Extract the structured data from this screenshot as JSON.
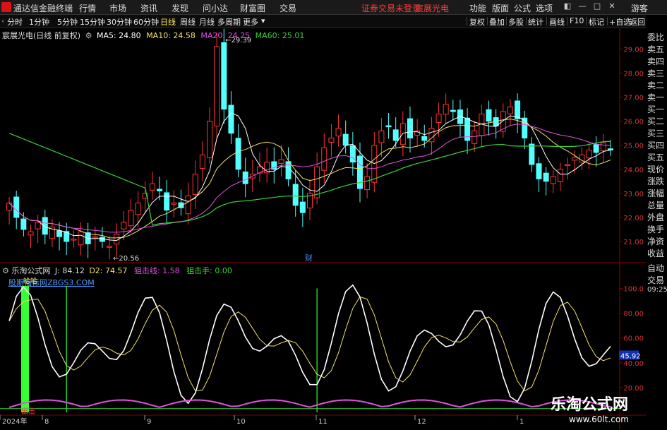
{
  "app": {
    "title": "通达信金融终端",
    "menu": [
      "行情",
      "市场",
      "资讯",
      "发现",
      "问小达",
      "财富圈",
      "交易"
    ],
    "status_red": [
      "证券交易未登录",
      "宸展光电"
    ],
    "right_menu": [
      "功能",
      "版面",
      "公式",
      "选项"
    ],
    "guest": "游客"
  },
  "periods": [
    "分时",
    "1分钟",
    "5分钟",
    "15分钟",
    "30分钟",
    "60分钟",
    "日线",
    "周线",
    "月线",
    "多周期",
    "更多"
  ],
  "active_period": "日线",
  "tools": [
    "复权",
    "叠加",
    "多股",
    "统计",
    "画线",
    "F10",
    "标记",
    "+自选",
    "返回"
  ],
  "price_panel": {
    "stock": "宸展光电(日线 前复权)",
    "ma": [
      {
        "label": "MA5: 24.80",
        "color": "#ffffff"
      },
      {
        "label": "MA10: 24.58",
        "color": "#f3e36a"
      },
      {
        "label": "MA20: 24.25",
        "color": "#e052e0"
      },
      {
        "label": "MA60: 25.01",
        "color": "#3bd23b"
      }
    ],
    "high_label": "29.39",
    "low_label": "20.56",
    "fin_marker": "财",
    "y_ticks": [
      "29.00",
      "28.00",
      "27.00",
      "26.00",
      "25.00",
      "24.00",
      "23.00",
      "22.00",
      "21.00"
    ]
  },
  "indicator_panel": {
    "name": "乐淘公式网",
    "j": "J: 84.12",
    "d2": "D2: 74.57",
    "line1": "狙击线: 1.58",
    "line2": "狙击手: 0.00",
    "site_text": "股期指标网ZBGS3.COM",
    "tag_top": "哈哈",
    "tag_bottom": "出击",
    "y_ticks": [
      "100.0",
      "80.00",
      "60.00",
      "40.00",
      "20.00"
    ],
    "current_value": "45.92"
  },
  "x_axis": [
    "2024年",
    "8",
    "9",
    "10",
    "11",
    "12",
    "1"
  ],
  "side_panel": [
    "委比",
    "卖五",
    "卖四",
    "卖三",
    "卖二",
    "卖一",
    "买一",
    "买二",
    "买三",
    "买四",
    "买五",
    "现价",
    "涨跌",
    "涨幅",
    "总量",
    "外盘",
    "换手",
    "净资",
    "收益",
    "自动",
    "交易",
    "09:25"
  ],
  "watermark": {
    "title": "乐淘公式网",
    "url": "www.60lt.com"
  },
  "colors": {
    "up": "#ff3333",
    "down": "#54ffff",
    "ma5": "#ffffff",
    "ma10": "#f3e36a",
    "ma20": "#e052e0",
    "ma60": "#3bd23b",
    "grid": "#8b0000"
  },
  "chart_data": {
    "type": "candlestick",
    "closes": [
      22.6,
      22.0,
      21.5,
      21.4,
      21.8,
      21.3,
      21.6,
      21.2,
      21.0,
      21.1,
      21.4,
      20.9,
      21.2,
      21.0,
      20.8,
      21.3,
      21.8,
      22.3,
      22.6,
      23.0,
      23.4,
      23.1,
      22.3,
      22.6,
      22.4,
      22.9,
      23.8,
      24.6,
      26.0,
      29.1,
      26.5,
      25.5,
      24.0,
      23.4,
      23.8,
      24.1,
      24.3,
      24.0,
      24.4,
      23.6,
      22.5,
      22.2,
      23.0,
      24.1,
      24.9,
      25.3,
      25.7,
      25.0,
      24.3,
      23.2,
      23.7,
      25.0,
      25.6,
      25.8,
      25.2,
      25.9,
      25.3,
      25.6,
      25.2,
      25.7,
      26.3,
      26.7,
      26.4,
      25.9,
      25.2,
      25.6,
      26.3,
      26.0,
      25.8,
      26.4,
      26.6,
      26.1,
      25.3,
      24.2,
      23.6,
      23.5,
      23.7,
      24.0,
      24.2,
      24.5,
      24.6,
      24.8,
      24.7,
      25.1,
      24.8
    ],
    "ylim": [
      20.5,
      29.6
    ],
    "indicator_ylim": [
      0,
      110
    ]
  }
}
